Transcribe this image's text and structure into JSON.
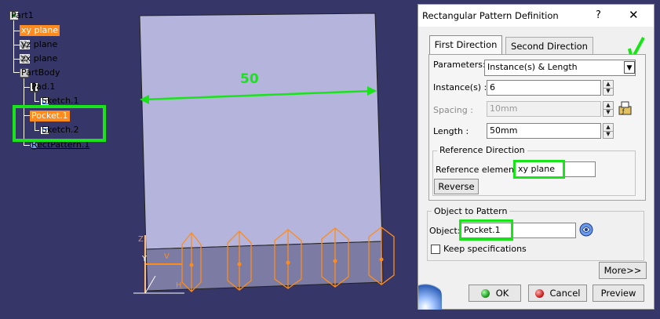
{
  "tree": {
    "part": "Part1",
    "planes": [
      "xy plane",
      "yz plane",
      "zx plane"
    ],
    "body": "PartBody",
    "pad": "Pad.1",
    "sketch1": "Sketch.1",
    "pocket": "Pocket.1",
    "sketch2": "Sketch.2",
    "pattern": "RectPattern.1"
  },
  "viewport": {
    "dimension_value": "50",
    "axis_labels": {
      "z": "Z",
      "y": "Y",
      "h": "H",
      "v": "V"
    }
  },
  "dialog": {
    "title": "Rectangular Pattern Definition",
    "help": "?",
    "close": "✕",
    "tabs": [
      "First Direction",
      "Second Direction"
    ],
    "parameters_label": "Parameters:",
    "parameters_value": "Instance(s) & Length",
    "instances_label": "Instance(s) :",
    "instances_value": "6",
    "spacing_label": "Spacing :",
    "spacing_value": "10mm",
    "length_label": "Length :",
    "length_value": "50mm",
    "ref_group": "Reference Direction",
    "ref_element_label": "Reference element:",
    "ref_element_value": "xy plane",
    "reverse": "Reverse",
    "obj_group": "Object to Pattern",
    "object_label": "Object:",
    "object_value": "Pocket.1",
    "keep_spec": "Keep specifications",
    "more": "More>>",
    "ok": "OK",
    "cancel": "Cancel",
    "preview": "Preview"
  },
  "colors": {
    "background": "#363668",
    "highlight": "#19e319",
    "selection": "#ff8a1e",
    "plate_fill": "#b4b4dc",
    "preview_orange": "#ff8c1a"
  }
}
